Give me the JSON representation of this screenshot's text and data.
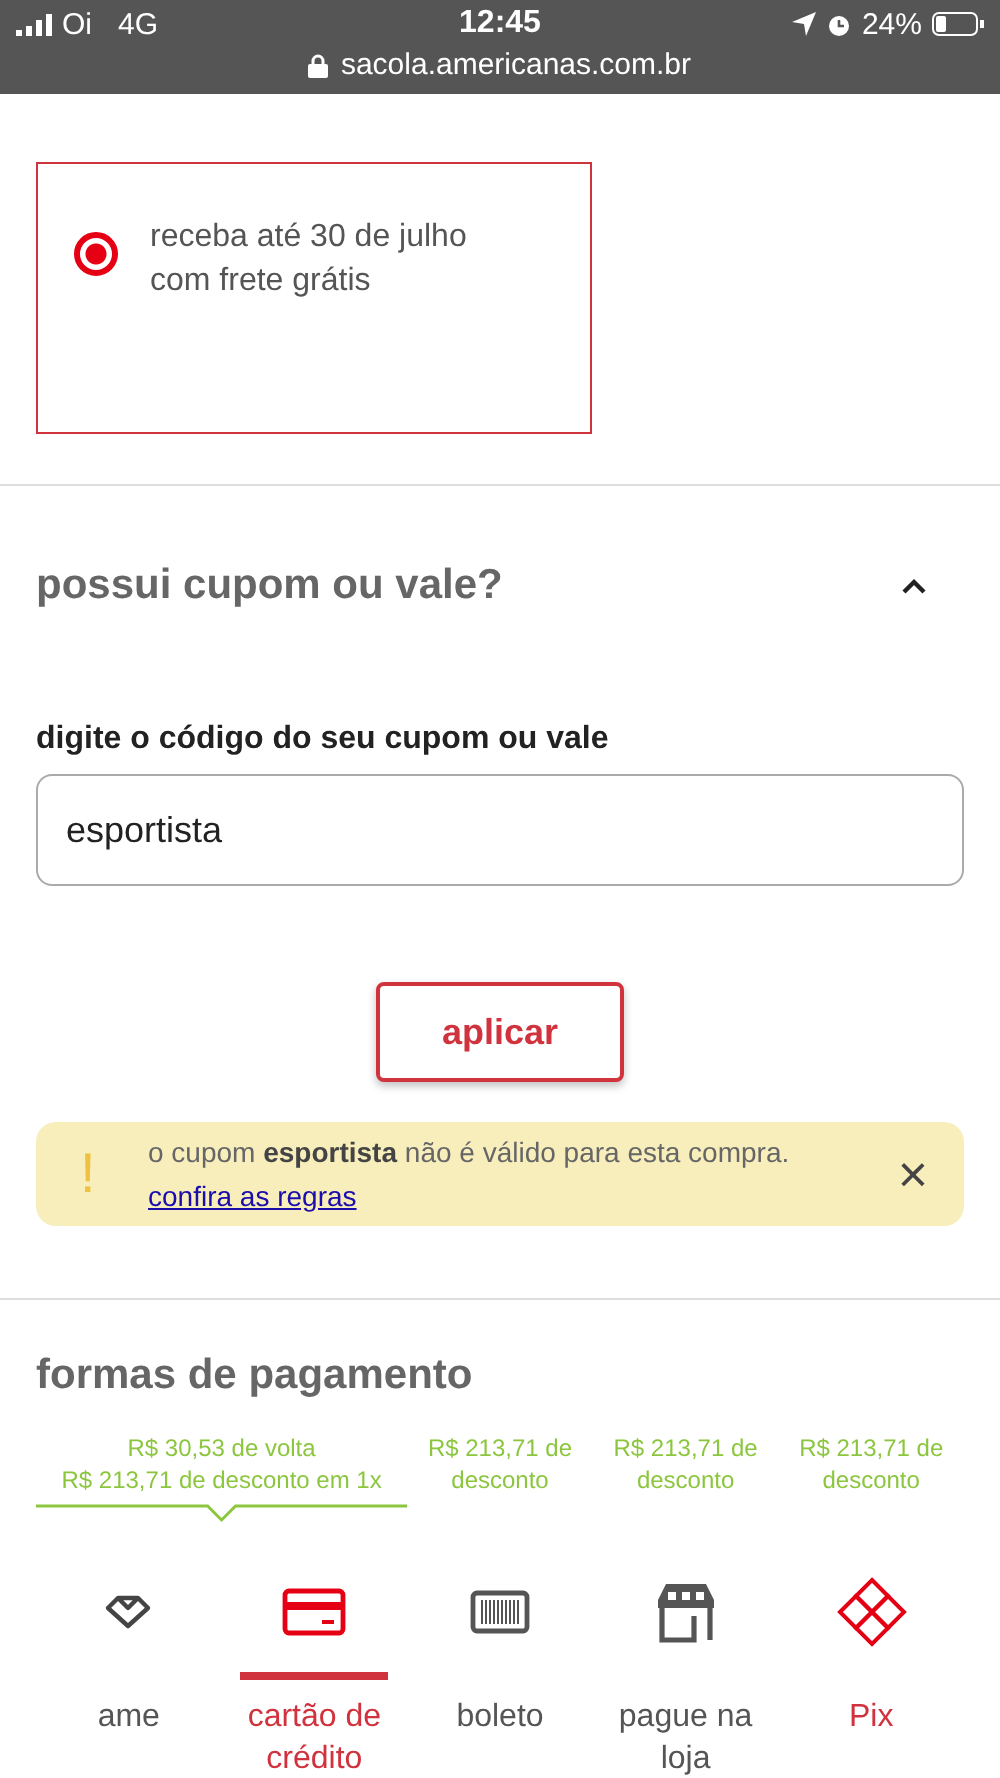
{
  "status_bar": {
    "carrier": "Oi",
    "network": "4G",
    "time": "12:45",
    "battery": "24%",
    "url": "sacola.americanas.com.br"
  },
  "delivery_option": {
    "text": "receba até 30 de julho com frete grátis",
    "selected": true
  },
  "coupon": {
    "title": "possui cupom ou vale?",
    "expanded": true,
    "label": "digite o código do seu cupom ou vale",
    "value": "esportista",
    "button": "aplicar",
    "alert": {
      "icon": "!",
      "message": "o cupom **esportista** não é válido para esta compra.",
      "link": "confira as regras",
      "close": "×"
    }
  },
  "payment": {
    "title": "formas de pagamento",
    "offers": [
      {
        "lines": [
          "R$ 30,53 de volta",
          "R$ 213,71 de desconto em 1x"
        ],
        "selected": true
      },
      {
        "lines": [
          "R$ 213,71 de",
          "desconto"
        ],
        "selected": false
      },
      {
        "lines": [
          "R$ 213,71 de",
          "desconto"
        ],
        "selected": false
      },
      {
        "lines": [
          "R$ 213,71 de",
          "desconto"
        ],
        "selected": false
      }
    ],
    "methods": [
      {
        "kind": "ame",
        "label": "ame",
        "selected": false
      },
      {
        "kind": "card",
        "label": "cartão de crédito",
        "selected": true
      },
      {
        "kind": "boleto",
        "label": "boleto",
        "selected": false
      },
      {
        "kind": "store",
        "label": "pague na loja",
        "selected": false
      },
      {
        "kind": "pix",
        "label": "Pix",
        "selected": false
      }
    ]
  }
}
